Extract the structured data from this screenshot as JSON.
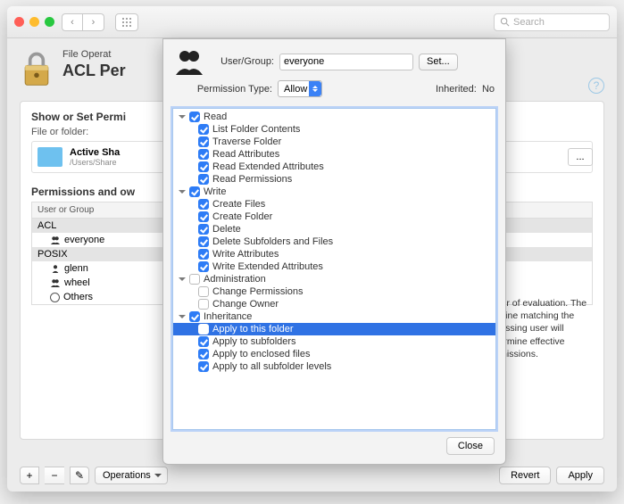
{
  "window": {
    "search_placeholder": "Search",
    "subtitle": "File Operat",
    "title": "ACL Per"
  },
  "panel": {
    "heading": "Show or Set Permi",
    "file_label": "File or folder:",
    "file_name": "Active Sha",
    "file_path": "/Users/Share",
    "dots": "...",
    "section2": "Permissions and ow",
    "list_header": "User or Group",
    "groups": {
      "acl": "ACL",
      "posix": "POSIX"
    },
    "rows": {
      "everyone": "everyone",
      "glenn": "glenn",
      "wheel": "wheel",
      "others": "Others"
    }
  },
  "side": {
    "text": "Order of evaluation. The first line matching the accessing user will determine effective permissions."
  },
  "bottom": {
    "plus": "+",
    "minus": "−",
    "pencil": "✎",
    "operations": "Operations",
    "revert": "Revert",
    "apply": "Apply"
  },
  "sheet": {
    "user_group_label": "User/Group:",
    "user_group_value": "everyone",
    "set": "Set...",
    "perm_type_label": "Permission Type:",
    "perm_type_value": "Allow",
    "inherited_label": "Inherited:",
    "inherited_value": "No",
    "close": "Close",
    "tree": [
      {
        "label": "Read",
        "checked": true,
        "level": 1,
        "expandable": true
      },
      {
        "label": "List Folder Contents",
        "checked": true,
        "level": 2
      },
      {
        "label": "Traverse Folder",
        "checked": true,
        "level": 2
      },
      {
        "label": "Read Attributes",
        "checked": true,
        "level": 2
      },
      {
        "label": "Read Extended Attributes",
        "checked": true,
        "level": 2
      },
      {
        "label": "Read Permissions",
        "checked": true,
        "level": 2
      },
      {
        "label": "Write",
        "checked": true,
        "level": 1,
        "expandable": true
      },
      {
        "label": "Create Files",
        "checked": true,
        "level": 2
      },
      {
        "label": "Create Folder",
        "checked": true,
        "level": 2
      },
      {
        "label": "Delete",
        "checked": true,
        "level": 2
      },
      {
        "label": "Delete Subfolders and Files",
        "checked": true,
        "level": 2
      },
      {
        "label": "Write Attributes",
        "checked": true,
        "level": 2
      },
      {
        "label": "Write Extended Attributes",
        "checked": true,
        "level": 2
      },
      {
        "label": "Administration",
        "checked": false,
        "level": 1,
        "expandable": true
      },
      {
        "label": "Change Permissions",
        "checked": false,
        "level": 2
      },
      {
        "label": "Change Owner",
        "checked": false,
        "level": 2
      },
      {
        "label": "Inheritance",
        "checked": true,
        "level": 1,
        "expandable": true
      },
      {
        "label": "Apply to this folder",
        "checked": true,
        "level": 2,
        "selected": true
      },
      {
        "label": "Apply to subfolders",
        "checked": true,
        "level": 2
      },
      {
        "label": "Apply to enclosed files",
        "checked": true,
        "level": 2
      },
      {
        "label": "Apply to all subfolder levels",
        "checked": true,
        "level": 2
      }
    ]
  }
}
